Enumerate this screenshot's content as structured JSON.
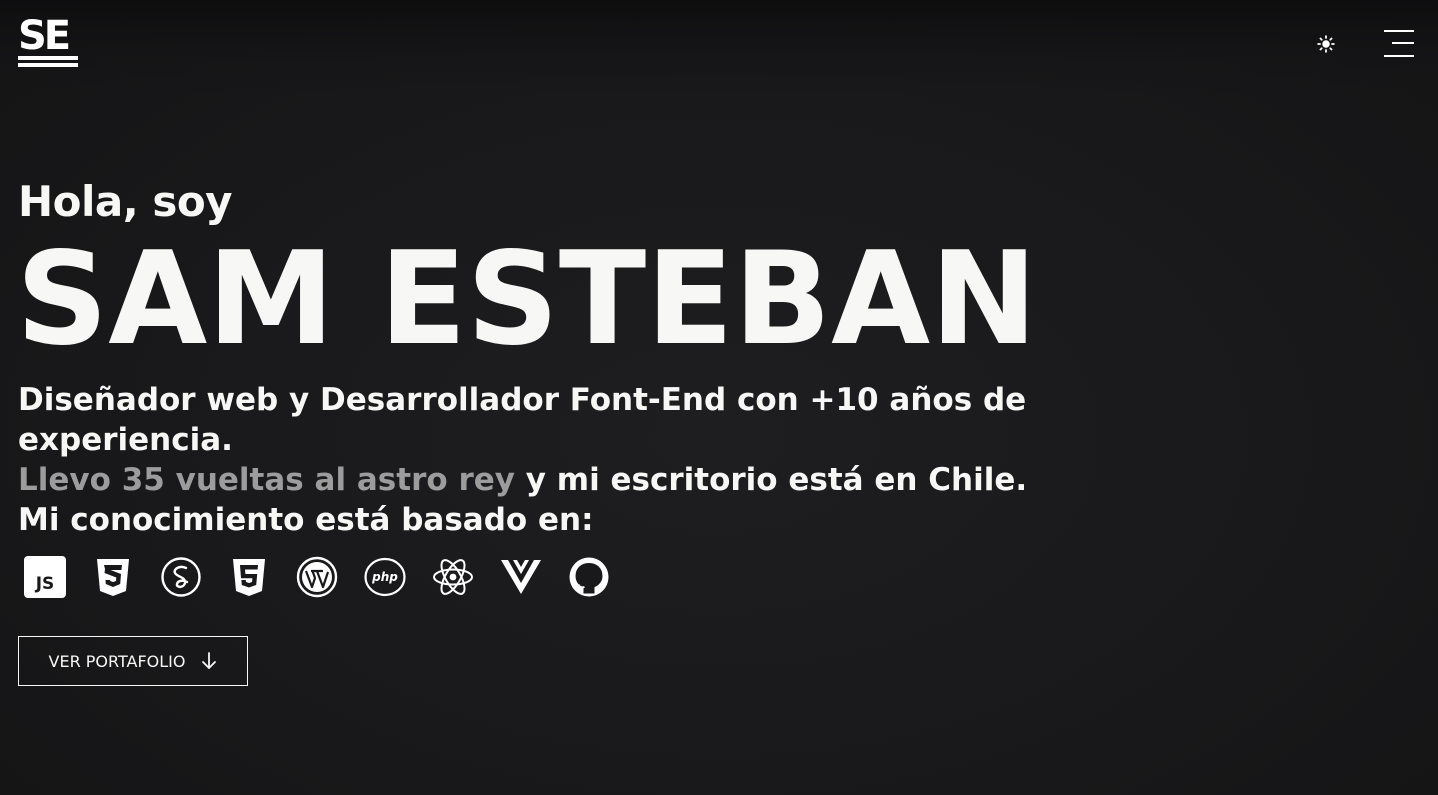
{
  "header": {
    "logo_text": "SE",
    "theme_toggle_icon": "sun-icon",
    "menu_icon": "hamburger-menu-icon"
  },
  "hero": {
    "greeting": "Hola, soy",
    "name": "SAM ESTEBAN",
    "bio_line1": "Diseñador web y Desarrollador Font-End con +10 años de experiencia.",
    "bio_highlight": "Llevo 35 vueltas al astro rey",
    "bio_line2_rest": " y mi escritorio está en Chile.",
    "bio_line3": "Mi conocimiento está basado en:"
  },
  "technologies": [
    {
      "name": "javascript-icon",
      "label": "JS"
    },
    {
      "name": "css3-icon"
    },
    {
      "name": "sass-icon"
    },
    {
      "name": "html5-icon"
    },
    {
      "name": "wordpress-icon"
    },
    {
      "name": "php-icon",
      "label": "php"
    },
    {
      "name": "react-icon"
    },
    {
      "name": "vue-icon"
    },
    {
      "name": "github-icon"
    }
  ],
  "cta": {
    "label": "VER PORTAFOLIO",
    "icon": "arrow-down-icon"
  },
  "colors": {
    "background": "#19191b",
    "text": "#f7f7f5",
    "muted": "#9c9c9c"
  }
}
